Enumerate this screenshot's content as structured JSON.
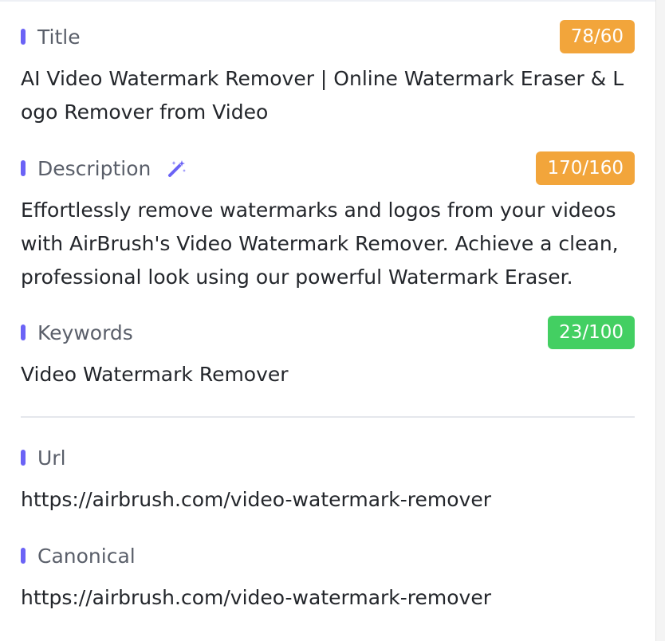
{
  "colors": {
    "accent_bar": "#6b63f6",
    "badge_warning": "#f2a53b",
    "badge_ok": "#43cf62",
    "label_text": "#5a5f6a",
    "value_text": "#23262b"
  },
  "title": {
    "label": "Title",
    "count": "78/60",
    "status": "warning",
    "value": "AI Video Watermark Remover | Online Watermark Eraser & Logo Remover from Video"
  },
  "description": {
    "label": "Description",
    "icon": "magic-wand-icon",
    "count": "170/160",
    "status": "warning",
    "value": "Effortlessly remove watermarks and logos from your videos with AirBrush's Video Watermark Remover. Achieve a clean, professional look using our powerful Watermark Eraser."
  },
  "keywords": {
    "label": "Keywords",
    "count": "23/100",
    "status": "ok",
    "value": "Video Watermark Remover"
  },
  "url": {
    "label": "Url",
    "value": "https://airbrush.com/video-watermark-remover"
  },
  "canonical": {
    "label": "Canonical",
    "value": "https://airbrush.com/video-watermark-remover"
  }
}
